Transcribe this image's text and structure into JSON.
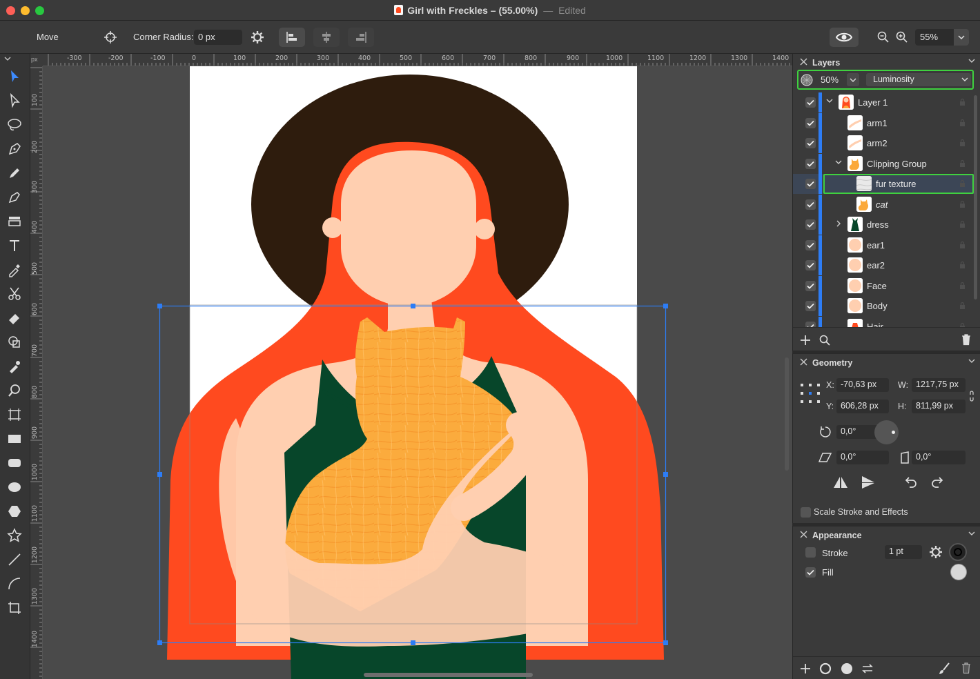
{
  "window": {
    "title": "Girl with Freckles – (55.00%)",
    "separator": "—",
    "status": "Edited"
  },
  "toolbar": {
    "tool_name": "Move",
    "corner_radius_label": "Corner Radius:",
    "corner_radius_value": "0 px",
    "zoom_value": "55%"
  },
  "rulers": {
    "unit": "px",
    "top_ticks": [
      "-300",
      "-200",
      "-100",
      "0",
      "100",
      "200",
      "300",
      "400",
      "500",
      "600",
      "700",
      "800",
      "900",
      "1000",
      "1100",
      "1200",
      "1300",
      "1400"
    ],
    "left_ticks": [
      "100",
      "200",
      "300",
      "400",
      "500",
      "600",
      "700",
      "800",
      "900",
      "1000",
      "1100",
      "1200",
      "1300",
      "1400"
    ]
  },
  "layers_panel": {
    "title": "Layers",
    "opacity": "50%",
    "blend_mode": "Luminosity",
    "items": [
      {
        "name": "Layer 1",
        "expanded": true,
        "level": 0,
        "thumb": "girl"
      },
      {
        "name": "arm1",
        "level": 1,
        "thumb": "arm"
      },
      {
        "name": "arm2",
        "level": 1,
        "thumb": "arm"
      },
      {
        "name": "Clipping Group",
        "expanded": true,
        "level": 1,
        "thumb": "cat"
      },
      {
        "name": "fur texture",
        "level": 2,
        "thumb": "texture",
        "selected": true
      },
      {
        "name": "cat",
        "level": 2,
        "thumb": "cat",
        "italic": true
      },
      {
        "name": "dress",
        "collapsed": true,
        "level": 1,
        "thumb": "dress"
      },
      {
        "name": "ear1",
        "level": 1,
        "thumb": "skin"
      },
      {
        "name": "ear2",
        "level": 1,
        "thumb": "skin"
      },
      {
        "name": "Face",
        "level": 1,
        "thumb": "skin"
      },
      {
        "name": "Body",
        "level": 1,
        "thumb": "skin"
      },
      {
        "name": "Hair",
        "level": 1,
        "thumb": "hair"
      }
    ]
  },
  "geometry_panel": {
    "title": "Geometry",
    "x_label": "X:",
    "x_value": "-70,63 px",
    "y_label": "Y:",
    "y_value": "606,28 px",
    "w_label": "W:",
    "w_value": "1217,75 px",
    "h_label": "H:",
    "h_value": "811,99 px",
    "rotation": "0,0°",
    "shear": "0,0°",
    "skew": "0,0°",
    "scale_stroke_label": "Scale Stroke and Effects"
  },
  "appearance_panel": {
    "title": "Appearance",
    "stroke_label": "Stroke",
    "stroke_width": "1 pt",
    "fill_label": "Fill"
  },
  "colors": {
    "selection_blue": "#2d7df6",
    "highlight_green": "#3fd13f",
    "hair_red": "#ff4a1f",
    "hat_brown": "#2e1c0d",
    "skin": "#ffcfb0",
    "dress_green": "#07462a",
    "cat_orange": "#fba93a"
  }
}
